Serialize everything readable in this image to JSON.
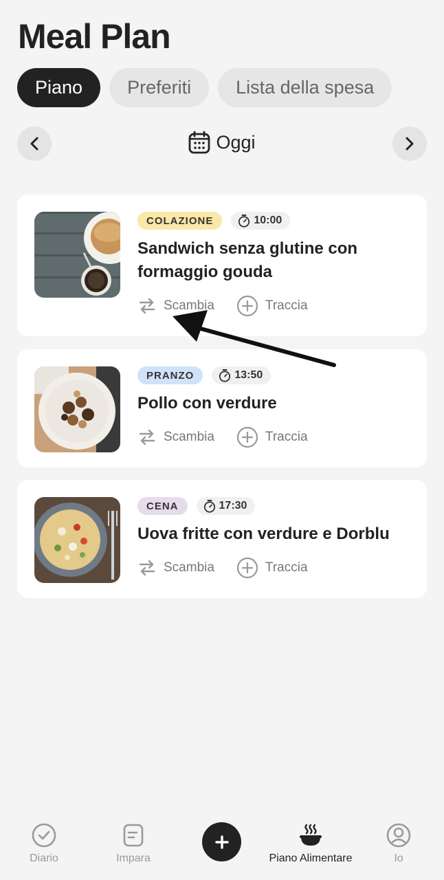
{
  "header": {
    "title": "Meal Plan"
  },
  "tabs": [
    {
      "label": "Piano",
      "active": true
    },
    {
      "label": "Preferiti",
      "active": false
    },
    {
      "label": "Lista della spesa",
      "active": false
    }
  ],
  "date_nav": {
    "label": "Oggi"
  },
  "meals": [
    {
      "type": "COLAZIONE",
      "type_color": "#f9e8a7",
      "time": "10:00",
      "title": "Sandwich senza glutine con formaggio gouda",
      "swap_label": "Scambia",
      "track_label": "Traccia"
    },
    {
      "type": "PRANZO",
      "type_color": "#cfe2f7",
      "time": "13:50",
      "title": "Pollo con verdure",
      "swap_label": "Scambia",
      "track_label": "Traccia"
    },
    {
      "type": "CENA",
      "type_color": "#e6dcec",
      "time": "17:30",
      "title": "Uova fritte con verdure e Dorblu",
      "swap_label": "Scambia",
      "track_label": "Traccia"
    }
  ],
  "bottom_nav": {
    "items": [
      {
        "label": "Diario",
        "icon": "check-circle-icon",
        "active": false
      },
      {
        "label": "Impara",
        "icon": "document-icon",
        "active": false
      },
      {
        "label": "Piano Alimentare",
        "icon": "bowl-icon",
        "active": true
      },
      {
        "label": "Io",
        "icon": "user-icon",
        "active": false
      }
    ],
    "add_icon": "plus-icon"
  }
}
